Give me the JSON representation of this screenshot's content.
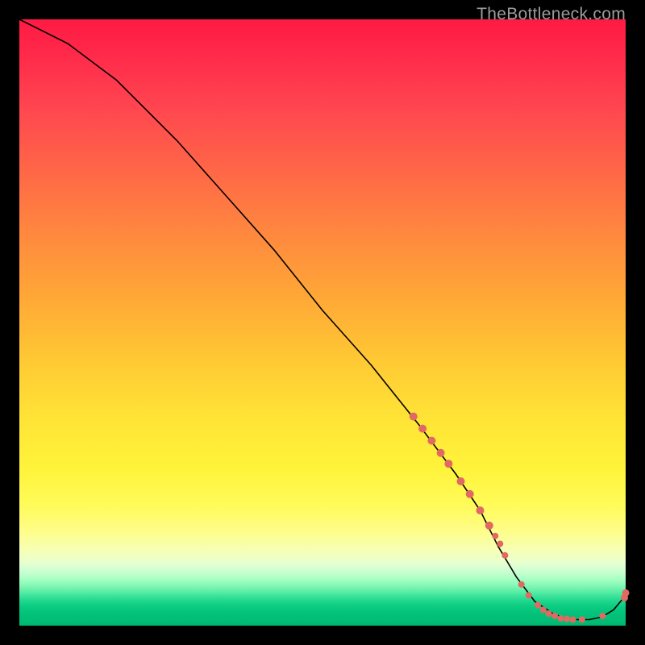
{
  "watermark": "TheBottleneck.com",
  "colors": {
    "dot": "#e06a62",
    "curve": "#000000"
  },
  "chart_data": {
    "type": "line",
    "title": "",
    "xlabel": "",
    "ylabel": "",
    "xlim": [
      0,
      100
    ],
    "ylim": [
      0,
      100
    ],
    "grid": false,
    "legend": false,
    "series": [
      {
        "name": "bottleneck-curve",
        "x": [
          0,
          4,
          8,
          12,
          16,
          20,
          26,
          34,
          42,
          50,
          58,
          66,
          72,
          76,
          79,
          82,
          85,
          88,
          90,
          92,
          94,
          96,
          98,
          100
        ],
        "y": [
          100,
          98,
          96,
          93,
          90,
          86,
          80,
          71,
          62,
          52,
          43,
          33,
          25,
          19,
          13,
          8,
          4,
          2,
          1.2,
          1.0,
          1.0,
          1.4,
          2.6,
          5
        ]
      }
    ],
    "markers": [
      {
        "x": 65.0,
        "y": 34.5,
        "r": 5
      },
      {
        "x": 66.5,
        "y": 32.5,
        "r": 5
      },
      {
        "x": 68.0,
        "y": 30.5,
        "r": 5
      },
      {
        "x": 69.5,
        "y": 28.5,
        "r": 5
      },
      {
        "x": 70.8,
        "y": 26.7,
        "r": 5
      },
      {
        "x": 72.8,
        "y": 23.8,
        "r": 5
      },
      {
        "x": 74.3,
        "y": 21.7,
        "r": 5
      },
      {
        "x": 76.0,
        "y": 19.0,
        "r": 5
      },
      {
        "x": 77.5,
        "y": 16.5,
        "r": 5
      },
      {
        "x": 78.5,
        "y": 14.8,
        "r": 4
      },
      {
        "x": 79.3,
        "y": 13.5,
        "r": 4
      },
      {
        "x": 80.1,
        "y": 11.6,
        "r": 4
      },
      {
        "x": 82.8,
        "y": 6.8,
        "r": 4
      },
      {
        "x": 84.0,
        "y": 5.0,
        "r": 4
      },
      {
        "x": 85.5,
        "y": 3.4,
        "r": 4
      },
      {
        "x": 86.4,
        "y": 2.6,
        "r": 4
      },
      {
        "x": 87.3,
        "y": 2.0,
        "r": 4
      },
      {
        "x": 88.3,
        "y": 1.6,
        "r": 4
      },
      {
        "x": 89.3,
        "y": 1.2,
        "r": 4
      },
      {
        "x": 90.3,
        "y": 1.1,
        "r": 4
      },
      {
        "x": 91.3,
        "y": 1.0,
        "r": 4
      },
      {
        "x": 92.8,
        "y": 1.0,
        "r": 4
      },
      {
        "x": 96.2,
        "y": 1.6,
        "r": 4
      },
      {
        "x": 99.8,
        "y": 4.6,
        "r": 4.5
      },
      {
        "x": 100.0,
        "y": 5.4,
        "r": 4.5
      }
    ]
  }
}
